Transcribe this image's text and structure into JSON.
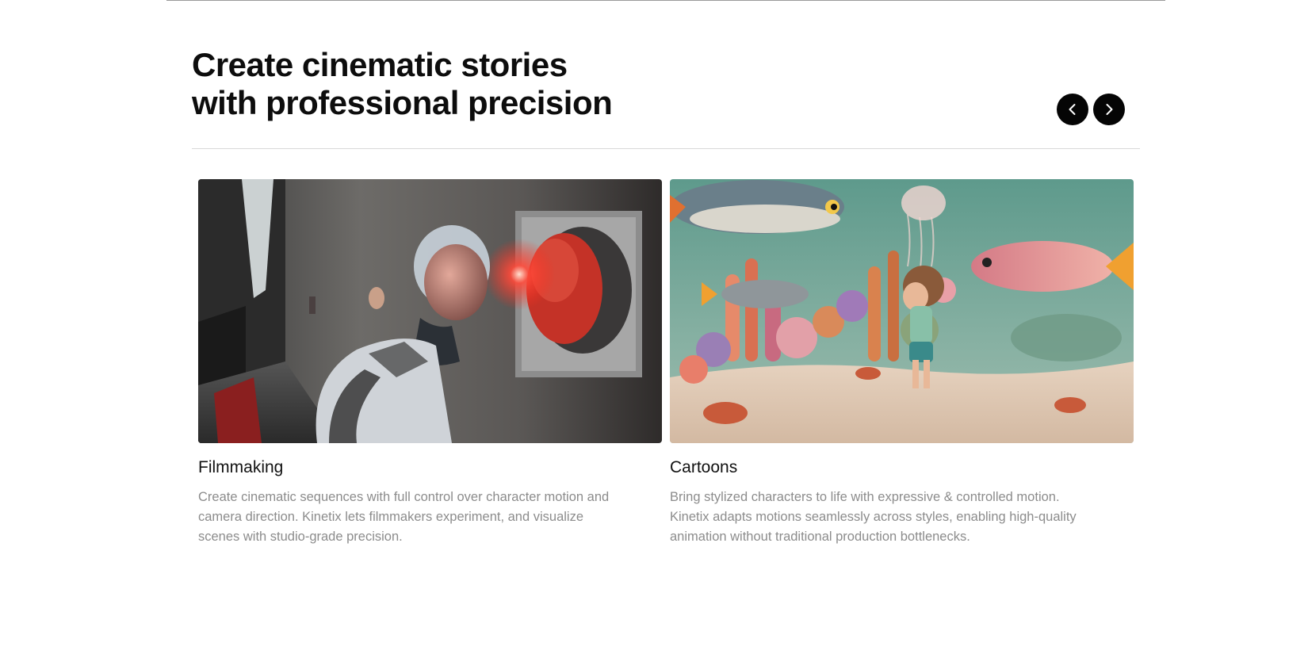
{
  "section": {
    "heading_line1": "Create cinematic stories",
    "heading_line2": "with professional precision"
  },
  "carousel": {
    "prev_icon": "chevron-left-icon",
    "next_icon": "chevron-right-icon",
    "button_color": "#050505"
  },
  "cards": [
    {
      "title": "Filmmaking",
      "description": "Create cinematic sequences with full control over character motion and camera direction. Kinetix lets filmmakers experiment, and visualize scenes with studio-grade precision."
    },
    {
      "title": "Cartoons",
      "description": "Bring stylized characters to life with expressive & controlled motion. Kinetix adapts motions seamlessly across styles, enabling high-quality animation without traditional production bottlenecks."
    }
  ]
}
